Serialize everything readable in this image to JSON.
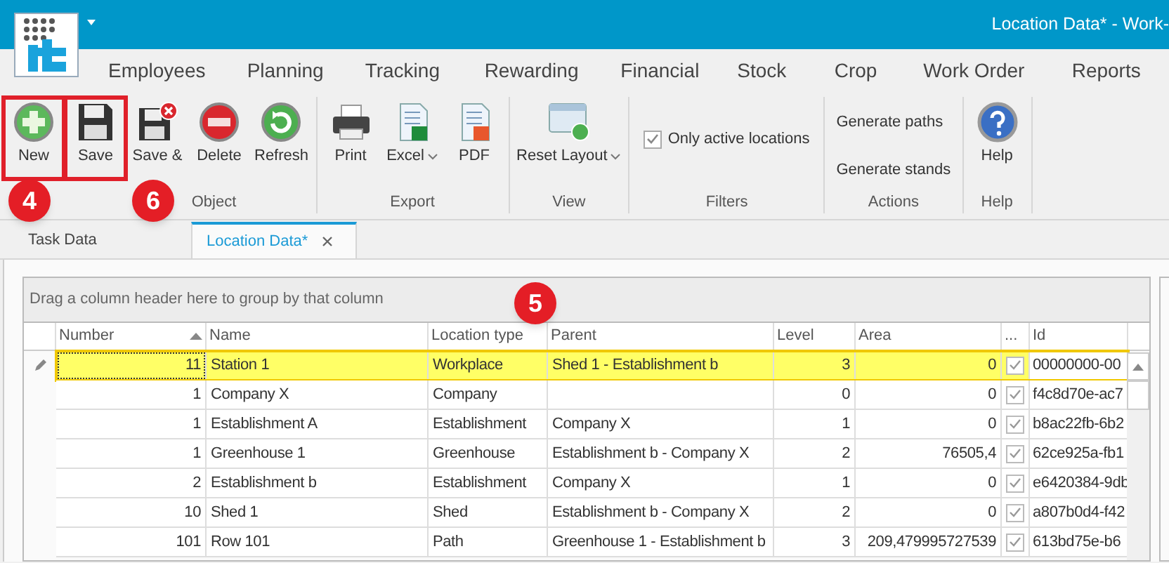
{
  "window": {
    "title": "Location Data* - Work-"
  },
  "menu": [
    {
      "label": "Employees"
    },
    {
      "label": "Planning"
    },
    {
      "label": "Tracking"
    },
    {
      "label": "Rewarding"
    },
    {
      "label": "Financial"
    },
    {
      "label": "Stock"
    },
    {
      "label": "Crop"
    },
    {
      "label": "Work Order"
    },
    {
      "label": "Reports"
    }
  ],
  "ribbon": [
    {
      "label": "Object",
      "items": [
        {
          "kind": "large",
          "label": "New",
          "highlighted": true
        },
        {
          "kind": "large",
          "label": "Save",
          "highlighted": true
        },
        {
          "kind": "large",
          "label": "Save &",
          "highlighted": false
        },
        {
          "kind": "large",
          "label": "Delete",
          "highlighted": false
        },
        {
          "kind": "large",
          "label": "Refresh",
          "highlighted": false
        }
      ]
    },
    {
      "label": "Export",
      "items": [
        {
          "kind": "large",
          "label": "Print",
          "highlighted": false
        },
        {
          "kind": "dropdown",
          "label": "Excel",
          "highlighted": false
        },
        {
          "kind": "large",
          "label": "PDF",
          "highlighted": false
        }
      ]
    },
    {
      "label": "View",
      "items": [
        {
          "kind": "dropdown",
          "label": "Reset Layout",
          "highlighted": false
        }
      ]
    },
    {
      "label": "Filters",
      "items": [
        {
          "kind": "checkbox",
          "label": "Only active locations",
          "checked": true
        }
      ]
    },
    {
      "label": "Actions",
      "items": [
        {
          "kind": "text",
          "label": "Generate paths"
        },
        {
          "kind": "text",
          "label": "Generate stands"
        }
      ]
    },
    {
      "label": "Help",
      "items": [
        {
          "kind": "large",
          "label": "Help",
          "highlighted": false
        }
      ]
    }
  ],
  "annotations": [
    {
      "label": "4"
    },
    {
      "label": "6"
    },
    {
      "label": "5"
    }
  ],
  "tabs": [
    {
      "label": "Task Data",
      "selected": false,
      "closable": false
    },
    {
      "label": "Location Data*",
      "selected": true,
      "closable": true
    }
  ],
  "grid": {
    "group_panel": "Drag a column header here to group by that column",
    "columns": [
      {
        "label": "Number",
        "sorted": true
      },
      {
        "label": "Name",
        "sorted": false
      },
      {
        "label": "Location type",
        "sorted": false
      },
      {
        "label": "Parent",
        "sorted": false
      },
      {
        "label": "Level",
        "sorted": false
      },
      {
        "label": "Area",
        "sorted": false
      },
      {
        "label": "...",
        "sorted": false
      },
      {
        "label": "Id",
        "sorted": false
      }
    ],
    "rows": [
      {
        "selected": true,
        "editing": true,
        "cells": [
          "11",
          "Station 1",
          "Workplace",
          "Shed 1 - Establishment b",
          "3",
          "0"
        ],
        "checked": true,
        "id": "00000000-00"
      },
      {
        "selected": false,
        "editing": false,
        "cells": [
          "1",
          "Company X",
          "Company",
          "",
          "0",
          "0"
        ],
        "checked": true,
        "id": "f4c8d70e-ac7"
      },
      {
        "selected": false,
        "editing": false,
        "cells": [
          "1",
          "Establishment A",
          "Establishment",
          "Company X",
          "1",
          "0"
        ],
        "checked": true,
        "id": "b8ac22fb-6b2"
      },
      {
        "selected": false,
        "editing": false,
        "cells": [
          "1",
          "Greenhouse 1",
          "Greenhouse",
          "Establishment b - Company X",
          "2",
          "76505,4"
        ],
        "checked": true,
        "id": "62ce925a-fb1"
      },
      {
        "selected": false,
        "editing": false,
        "cells": [
          "2",
          "Establishment b",
          "Establishment",
          "Company X",
          "1",
          "0"
        ],
        "checked": true,
        "id": "e6420384-9db"
      },
      {
        "selected": false,
        "editing": false,
        "cells": [
          "10",
          "Shed 1",
          "Shed",
          "Establishment b - Company X",
          "2",
          "0"
        ],
        "checked": true,
        "id": "a807b0d4-f42"
      },
      {
        "selected": false,
        "editing": false,
        "cells": [
          "101",
          "Row 101",
          "Path",
          "Greenhouse 1 - Establishment b",
          "3",
          "209,479995727539"
        ],
        "checked": true,
        "id": "613bd75e-b6"
      }
    ]
  }
}
